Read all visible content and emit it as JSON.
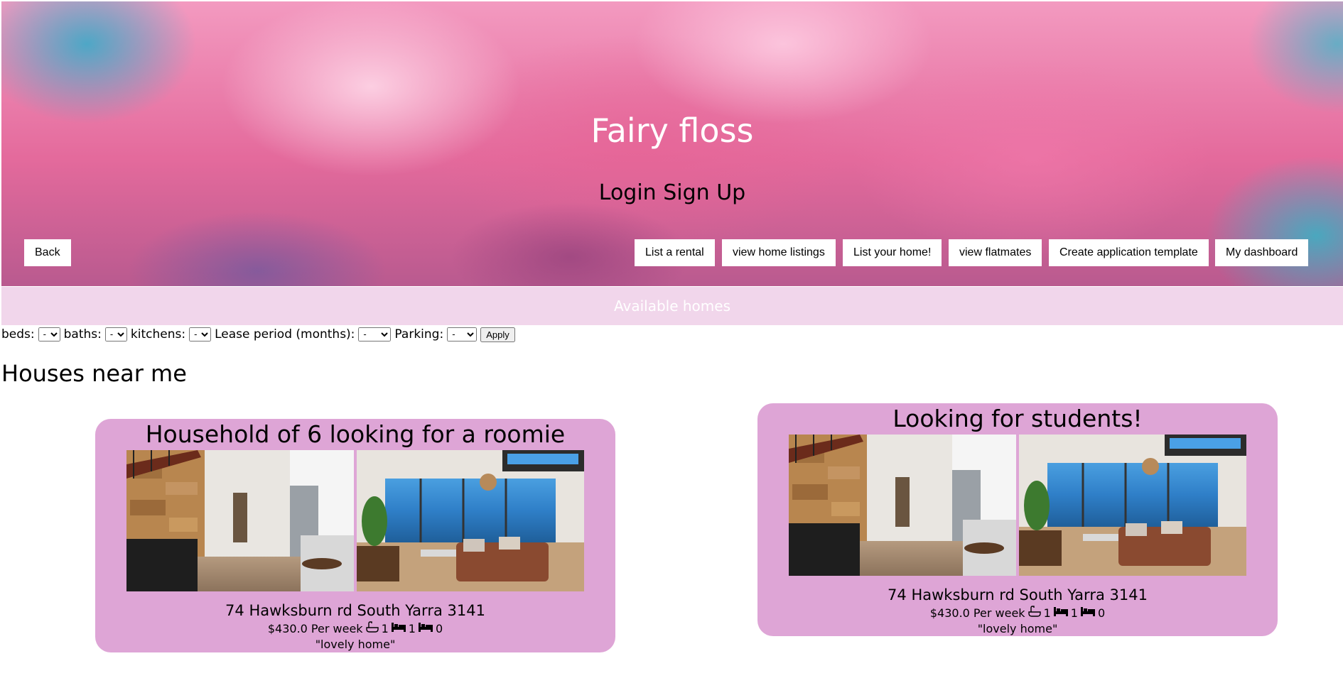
{
  "hero": {
    "title": "Fairy floss",
    "login": "Login",
    "signup": "Sign Up"
  },
  "nav": {
    "back": "Back",
    "list_rental": "List a rental",
    "view_home_listings": "view home listings",
    "list_your_home": "List your home!",
    "view_flatmates": "view flatmates",
    "create_application_template": "Create application template",
    "my_dashboard": "My dashboard"
  },
  "available_label": "Available homes",
  "filters": {
    "beds_label": "beds:",
    "baths_label": "baths:",
    "kitchens_label": "kitchens:",
    "lease_label": "Lease period (months):",
    "parking_label": "Parking:",
    "selected_value": "-",
    "apply_label": "Apply"
  },
  "section_title": "Houses near me",
  "listings": [
    {
      "title": "Household of 6 looking for a roomie",
      "address": "74 Hawksburn rd South Yarra 3141",
      "price": "$430.0 Per week",
      "baths": "1",
      "beds": "1",
      "parking": "0",
      "description": "\"lovely home\""
    },
    {
      "title": "Looking for students!",
      "address": "74 Hawksburn rd South Yarra 3141",
      "price": "$430.0 Per week",
      "baths": "1",
      "beds": "1",
      "parking": "0",
      "description": "\"lovely home\""
    }
  ],
  "icons": {
    "bath": "bath-icon",
    "bed": "bed-icon",
    "car": "car-icon"
  }
}
